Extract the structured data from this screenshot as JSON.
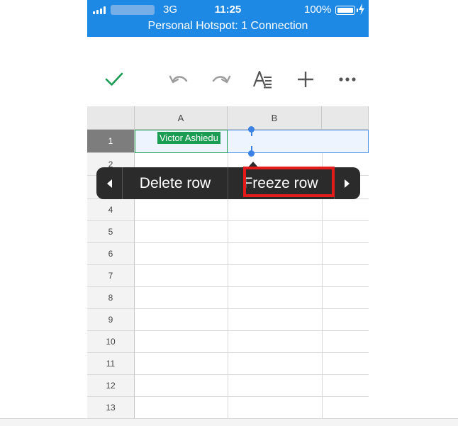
{
  "status_bar": {
    "network": "3G",
    "time": "11:25",
    "battery": "100%",
    "hotspot": "Personal Hotspot: 1 Connection",
    "icons": [
      "signal-icon",
      "battery-icon",
      "charging-icon"
    ]
  },
  "toolbar": {
    "icons": [
      "check-icon",
      "undo-icon",
      "redo-icon",
      "text-format-icon",
      "add-icon",
      "more-icon"
    ],
    "accent": "#1a9c53",
    "icon_color": "#999999"
  },
  "sheet": {
    "columns": [
      "A",
      "B"
    ],
    "rows": [
      "1",
      "2",
      "3",
      "4",
      "5",
      "6",
      "7",
      "8",
      "9",
      "10",
      "11",
      "12",
      "13"
    ],
    "selected_row": "1",
    "cells": {
      "A1": "Victor Ashiedu"
    }
  },
  "context_menu": {
    "items": [
      "Delete row",
      "Freeze row"
    ],
    "highlighted": "Freeze row",
    "highlight_color": "#e31b1b"
  },
  "colors": {
    "status_bar": "#1e88e5",
    "selection": "#4a8fe7",
    "cell_label": "#1a9c53",
    "menu_background": "#2b2b2b"
  }
}
